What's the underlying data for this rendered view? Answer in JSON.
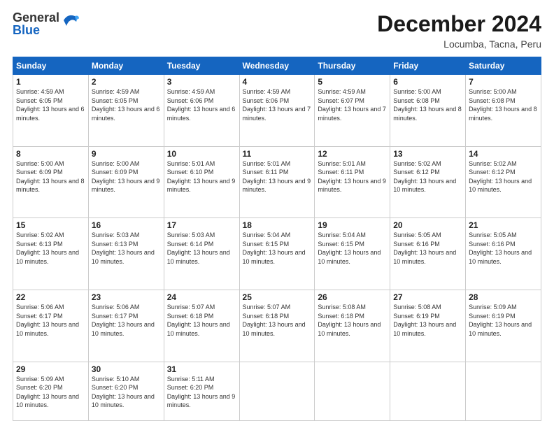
{
  "header": {
    "logo_general": "General",
    "logo_blue": "Blue",
    "month_title": "December 2024",
    "subtitle": "Locumba, Tacna, Peru"
  },
  "weekdays": [
    "Sunday",
    "Monday",
    "Tuesday",
    "Wednesday",
    "Thursday",
    "Friday",
    "Saturday"
  ],
  "weeks": [
    [
      {
        "day": "1",
        "sunrise": "4:59 AM",
        "sunset": "6:05 PM",
        "daylight": "13 hours and 6 minutes."
      },
      {
        "day": "2",
        "sunrise": "4:59 AM",
        "sunset": "6:05 PM",
        "daylight": "13 hours and 6 minutes."
      },
      {
        "day": "3",
        "sunrise": "4:59 AM",
        "sunset": "6:06 PM",
        "daylight": "13 hours and 6 minutes."
      },
      {
        "day": "4",
        "sunrise": "4:59 AM",
        "sunset": "6:06 PM",
        "daylight": "13 hours and 7 minutes."
      },
      {
        "day": "5",
        "sunrise": "4:59 AM",
        "sunset": "6:07 PM",
        "daylight": "13 hours and 7 minutes."
      },
      {
        "day": "6",
        "sunrise": "5:00 AM",
        "sunset": "6:08 PM",
        "daylight": "13 hours and 8 minutes."
      },
      {
        "day": "7",
        "sunrise": "5:00 AM",
        "sunset": "6:08 PM",
        "daylight": "13 hours and 8 minutes."
      }
    ],
    [
      {
        "day": "8",
        "sunrise": "5:00 AM",
        "sunset": "6:09 PM",
        "daylight": "13 hours and 8 minutes."
      },
      {
        "day": "9",
        "sunrise": "5:00 AM",
        "sunset": "6:09 PM",
        "daylight": "13 hours and 9 minutes."
      },
      {
        "day": "10",
        "sunrise": "5:01 AM",
        "sunset": "6:10 PM",
        "daylight": "13 hours and 9 minutes."
      },
      {
        "day": "11",
        "sunrise": "5:01 AM",
        "sunset": "6:11 PM",
        "daylight": "13 hours and 9 minutes."
      },
      {
        "day": "12",
        "sunrise": "5:01 AM",
        "sunset": "6:11 PM",
        "daylight": "13 hours and 9 minutes."
      },
      {
        "day": "13",
        "sunrise": "5:02 AM",
        "sunset": "6:12 PM",
        "daylight": "13 hours and 10 minutes."
      },
      {
        "day": "14",
        "sunrise": "5:02 AM",
        "sunset": "6:12 PM",
        "daylight": "13 hours and 10 minutes."
      }
    ],
    [
      {
        "day": "15",
        "sunrise": "5:02 AM",
        "sunset": "6:13 PM",
        "daylight": "13 hours and 10 minutes."
      },
      {
        "day": "16",
        "sunrise": "5:03 AM",
        "sunset": "6:13 PM",
        "daylight": "13 hours and 10 minutes."
      },
      {
        "day": "17",
        "sunrise": "5:03 AM",
        "sunset": "6:14 PM",
        "daylight": "13 hours and 10 minutes."
      },
      {
        "day": "18",
        "sunrise": "5:04 AM",
        "sunset": "6:15 PM",
        "daylight": "13 hours and 10 minutes."
      },
      {
        "day": "19",
        "sunrise": "5:04 AM",
        "sunset": "6:15 PM",
        "daylight": "13 hours and 10 minutes."
      },
      {
        "day": "20",
        "sunrise": "5:05 AM",
        "sunset": "6:16 PM",
        "daylight": "13 hours and 10 minutes."
      },
      {
        "day": "21",
        "sunrise": "5:05 AM",
        "sunset": "6:16 PM",
        "daylight": "13 hours and 10 minutes."
      }
    ],
    [
      {
        "day": "22",
        "sunrise": "5:06 AM",
        "sunset": "6:17 PM",
        "daylight": "13 hours and 10 minutes."
      },
      {
        "day": "23",
        "sunrise": "5:06 AM",
        "sunset": "6:17 PM",
        "daylight": "13 hours and 10 minutes."
      },
      {
        "day": "24",
        "sunrise": "5:07 AM",
        "sunset": "6:18 PM",
        "daylight": "13 hours and 10 minutes."
      },
      {
        "day": "25",
        "sunrise": "5:07 AM",
        "sunset": "6:18 PM",
        "daylight": "13 hours and 10 minutes."
      },
      {
        "day": "26",
        "sunrise": "5:08 AM",
        "sunset": "6:18 PM",
        "daylight": "13 hours and 10 minutes."
      },
      {
        "day": "27",
        "sunrise": "5:08 AM",
        "sunset": "6:19 PM",
        "daylight": "13 hours and 10 minutes."
      },
      {
        "day": "28",
        "sunrise": "5:09 AM",
        "sunset": "6:19 PM",
        "daylight": "13 hours and 10 minutes."
      }
    ],
    [
      {
        "day": "29",
        "sunrise": "5:09 AM",
        "sunset": "6:20 PM",
        "daylight": "13 hours and 10 minutes."
      },
      {
        "day": "30",
        "sunrise": "5:10 AM",
        "sunset": "6:20 PM",
        "daylight": "13 hours and 10 minutes."
      },
      {
        "day": "31",
        "sunrise": "5:11 AM",
        "sunset": "6:20 PM",
        "daylight": "13 hours and 9 minutes."
      },
      null,
      null,
      null,
      null
    ]
  ],
  "labels": {
    "sunrise": "Sunrise:",
    "sunset": "Sunset:",
    "daylight": "Daylight:"
  }
}
